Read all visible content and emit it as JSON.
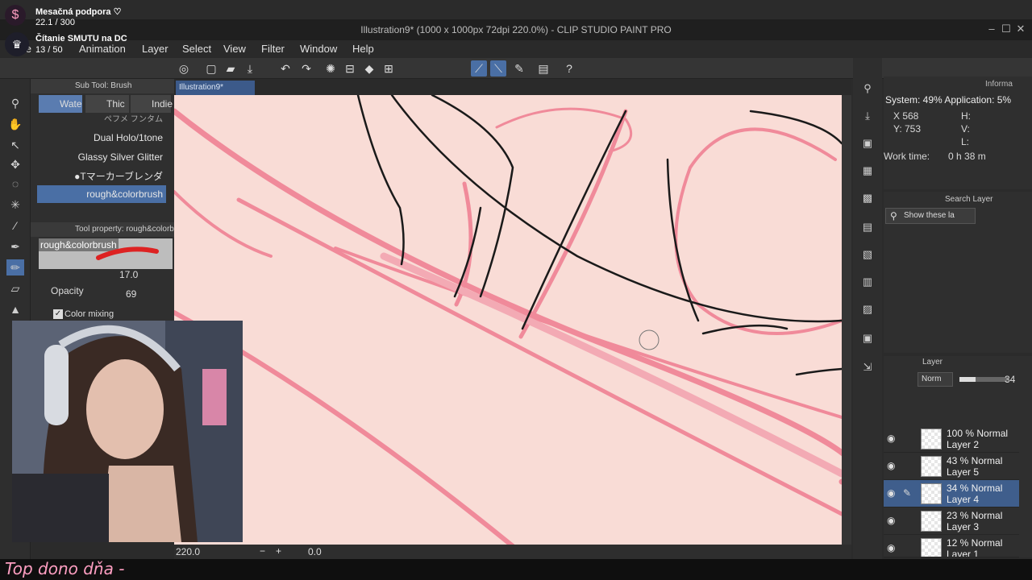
{
  "window": {
    "title": "Illustration9* (1000 x 1000px 72dpi 220.0%)  - CLIP STUDIO PAINT PRO"
  },
  "menu": [
    "File",
    "Animation",
    "Layer",
    "Select",
    "View",
    "Filter",
    "Window",
    "Help"
  ],
  "subtool_panel": {
    "header": "Sub Tool: Brush",
    "tabs": [
      "Wate",
      "Thic",
      "Indie"
    ],
    "brushes": [
      "ペフメ フンタム",
      "Dual Holo/1tone",
      "Glassy Silver Glitter",
      "●Tマーカーブレンダ",
      "rough&colorbrush"
    ],
    "selected_brush": "rough&colorbrush"
  },
  "tool_property": {
    "header": "Tool property: rough&colorb",
    "brush_name": "rough&colorbrush",
    "size_value": "17.0",
    "opacity_label": "Opacity",
    "opacity_value": "69",
    "color_mixing_label": "Color mixing"
  },
  "canvas": {
    "tab_label": "Illustration9*",
    "zoom": "220.0",
    "rotation": "0.0",
    "paper_color": "#f9dcd6",
    "stroke_pink": "#ee6f86",
    "stroke_black": "#1a1a1a"
  },
  "info_panel": {
    "title": "Informa",
    "system": "System: 49% Application:  5%",
    "x": "X  568",
    "y": "Y: 753",
    "h": "H:",
    "v": "V:",
    "l": "L:",
    "work_time_label": "Work time:",
    "work_time_value": "0 h 38 m"
  },
  "search_panel": {
    "title": "Search Layer",
    "filter": "Show these la"
  },
  "layer_panel": {
    "title": "Layer",
    "blend_mode": "Norm",
    "opacity": "34",
    "layers": [
      {
        "mode": "100 % Normal",
        "name": "Layer 2",
        "selected": false
      },
      {
        "mode": "43 % Normal",
        "name": "Layer 5",
        "selected": false
      },
      {
        "mode": "34 % Normal",
        "name": "Layer 4",
        "selected": true
      },
      {
        "mode": "23 % Normal",
        "name": "Layer 3",
        "selected": false
      },
      {
        "mode": "12 % Normal",
        "name": "Layer 1",
        "selected": false
      }
    ]
  },
  "stream_overlay": {
    "support_label": "Mesačná podpora ♡",
    "support_count": "22.1 / 300",
    "goal_label": "Čítanie SMUTU na DC",
    "goal_count": "13 / 50",
    "support_progress": 0.074,
    "goal_progress": 0.26,
    "top_donor": "Top dono dňa -"
  }
}
